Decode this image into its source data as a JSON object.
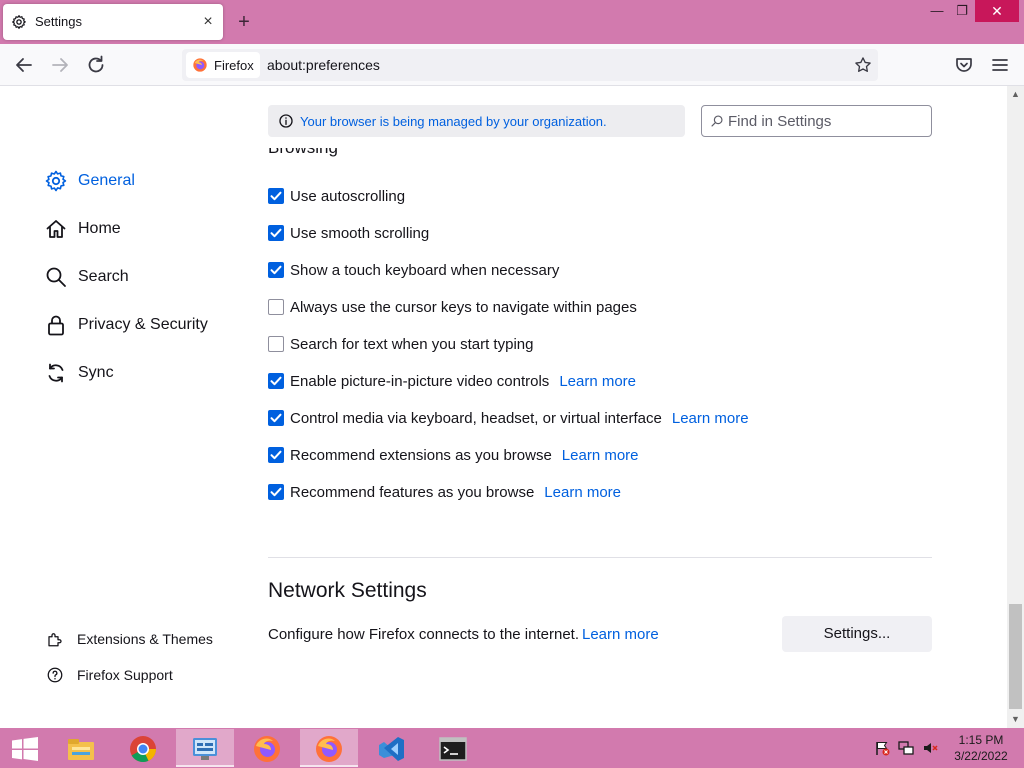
{
  "window": {
    "tab_title": "Settings",
    "tab_close_label": "×",
    "new_tab_label": "+",
    "minimize_label": "—",
    "maximize_label": "❐",
    "close_label": "✕"
  },
  "navbar": {
    "identity_label": "Firefox",
    "url": "about:preferences"
  },
  "sidebar": {
    "items": [
      {
        "label": "General",
        "icon": "gear-icon",
        "active": true
      },
      {
        "label": "Home",
        "icon": "home-icon"
      },
      {
        "label": "Search",
        "icon": "search-icon"
      },
      {
        "label": "Privacy & Security",
        "icon": "lock-icon"
      },
      {
        "label": "Sync",
        "icon": "sync-icon"
      }
    ],
    "footer": [
      {
        "label": "Extensions & Themes",
        "icon": "puzzle-icon"
      },
      {
        "label": "Firefox Support",
        "icon": "help-icon"
      }
    ]
  },
  "policy_notice": "Your browser is being managed by your organization.",
  "search": {
    "placeholder": "Find in Settings",
    "value": ""
  },
  "browsing": {
    "heading_partial": "Browsing",
    "options": [
      {
        "label": "Use autoscrolling",
        "checked": true
      },
      {
        "label": "Use smooth scrolling",
        "checked": true
      },
      {
        "label": "Show a touch keyboard when necessary",
        "checked": true
      },
      {
        "label": "Always use the cursor keys to navigate within pages",
        "checked": false
      },
      {
        "label": "Search for text when you start typing",
        "checked": false
      },
      {
        "label": "Enable picture-in-picture video controls",
        "checked": true,
        "link": "Learn more"
      },
      {
        "label": "Control media via keyboard, headset, or virtual interface",
        "checked": true,
        "link": "Learn more"
      },
      {
        "label": "Recommend extensions as you browse",
        "checked": true,
        "link": "Learn more"
      },
      {
        "label": "Recommend features as you browse",
        "checked": true,
        "link": "Learn more"
      }
    ]
  },
  "network": {
    "title": "Network Settings",
    "description": "Configure how Firefox connects to the internet.",
    "learn_more": "Learn more",
    "button_label": "Settings..."
  },
  "taskbar": {
    "apps": [
      "file-explorer-icon",
      "chrome-icon",
      "control-panel-icon",
      "firefox-icon",
      "firefox-icon",
      "visual-studio-icon",
      "command-prompt-icon"
    ],
    "time": "1:15 PM",
    "date": "3/22/2022"
  },
  "colors": {
    "accent": "#0060df",
    "chrome_pink": "#d27aae",
    "close_red": "#c8175a"
  }
}
